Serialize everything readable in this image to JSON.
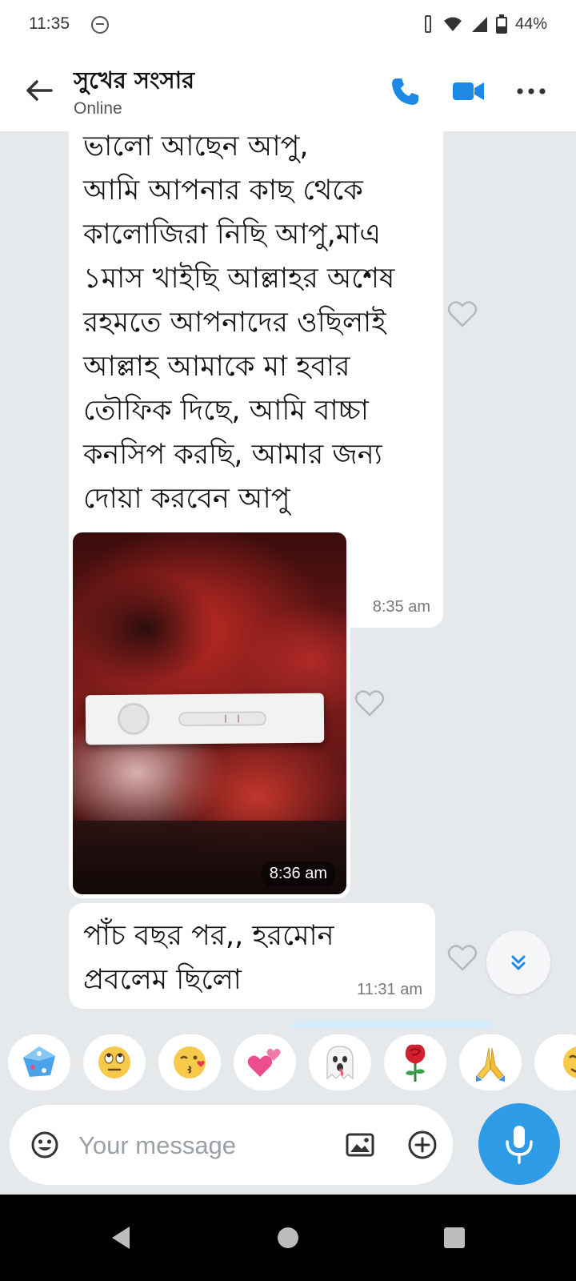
{
  "status_bar": {
    "time": "11:35",
    "battery": "44%",
    "battery_level": 0.44,
    "icons": [
      "notification-icon",
      "vibrate-icon",
      "wifi-icon",
      "signal-icon",
      "battery-icon"
    ]
  },
  "header": {
    "title": "সুখের সংসার",
    "status": "Online",
    "icons": [
      "back-arrow-icon",
      "phone-call-icon",
      "video-call-icon",
      "more-options-icon"
    ],
    "accent_color": "#1e88e5"
  },
  "messages": [
    {
      "type": "text",
      "text": "ভালো আছেন আপু,\nআমি আপনার কাছ থেকে\nকালোজিরা নিছি আপু,মাএ\n১মাস খাইছি আল্লাহর অশেষ\nরহমতে আপনাদের ওছিলাই\nআল্লাহ আমাকে মা হবার\nতৌফিক দিছে, আমি বাচ্চা\nকনসিপ করছি, আমার জন্য\nদোয়া করবেন আপু",
      "time": "8:35 am"
    },
    {
      "type": "photo",
      "time": "8:36 am"
    },
    {
      "type": "text",
      "text": "পাঁচ বছর পর,,  হরমোন\nপ্রবলেম ছিলো",
      "time": "11:31 am"
    }
  ],
  "quick_reactions": [
    "dice",
    "eye-roll",
    "kiss",
    "hearts",
    "ghost",
    "rose",
    "folded-hands",
    "wink"
  ],
  "composer": {
    "placeholder": "Your message",
    "icons": [
      "emoji-icon",
      "gallery-icon",
      "add-icon",
      "microphone-icon"
    ],
    "mic_color": "#2d9be6"
  },
  "nav_bar": {
    "icons": [
      "back-triangle-icon",
      "home-circle-icon",
      "recents-square-icon"
    ]
  }
}
